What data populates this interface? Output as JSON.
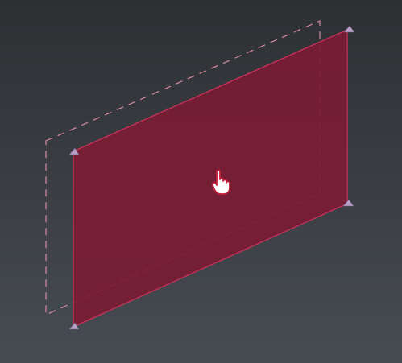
{
  "viewport": {
    "background_top": "#2d3033",
    "background_bottom": "#474c53"
  },
  "plane": {
    "fill": "#7a1c34",
    "fill_opacity": 0.93,
    "edge": "#c8325a",
    "state": "selected"
  },
  "preview_outline": {
    "stroke": "#d98aa0",
    "style": "dashed"
  },
  "handles": {
    "color": "#b8a0c8",
    "icon": "corner-handle-icon",
    "count": 4
  },
  "cursor": {
    "icon": "hand-pointer-icon",
    "fill": "#ffffff",
    "outline": "#c41e3a"
  }
}
